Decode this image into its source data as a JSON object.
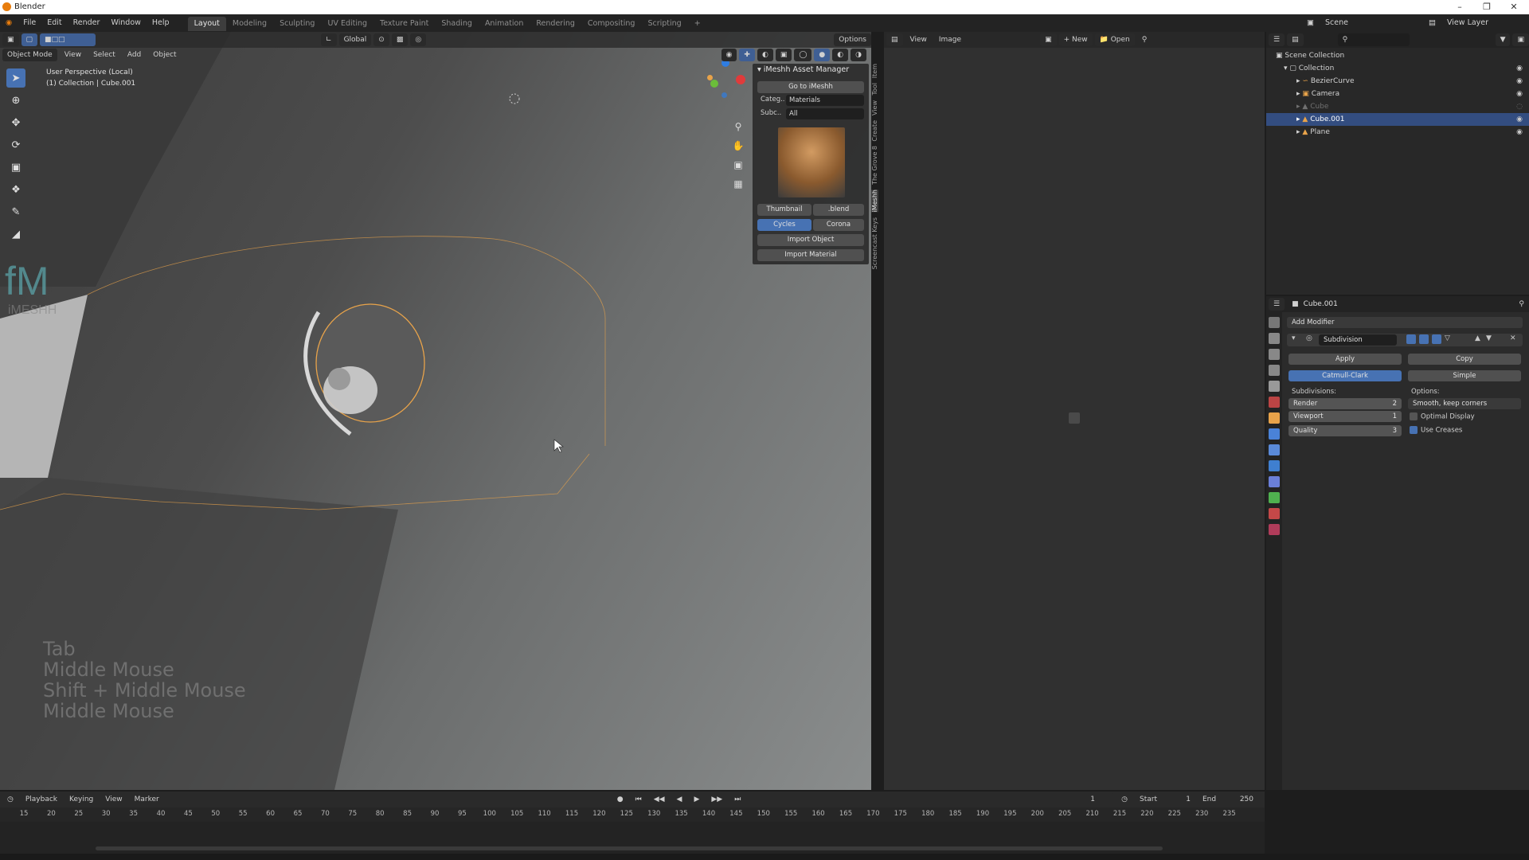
{
  "app": {
    "title": "Blender"
  },
  "menu": [
    "File",
    "Edit",
    "Render",
    "Window",
    "Help"
  ],
  "workspaces": [
    "Layout",
    "Modeling",
    "Sculpting",
    "UV Editing",
    "Texture Paint",
    "Shading",
    "Animation",
    "Rendering",
    "Compositing",
    "Scripting"
  ],
  "active_workspace": "Layout",
  "scene_label": "Scene",
  "view_layer_label": "View Layer",
  "viewport": {
    "transform_orientation": "Global",
    "options_label": "Options",
    "mode": "Object Mode",
    "header_menus": [
      "View",
      "Select",
      "Add",
      "Object"
    ],
    "perspective": "User Perspective (Local)",
    "collection_info": "(1) Collection | Cube.001",
    "key_overlay": [
      "Tab",
      "Middle Mouse",
      "Shift + Middle Mouse",
      "Middle Mouse"
    ],
    "watermark_logo_text": "iMESHH"
  },
  "npanel": {
    "title": "iMeshh Asset Manager",
    "goto_label": "Go to iMeshh",
    "category_label": "Categ..",
    "category_value": "Materials",
    "subcategory_label": "Subc..",
    "subcategory_value": "All",
    "thumbnail_label": "Thumbnail",
    "blend_label": ".blend",
    "engine_cycles": "Cycles",
    "engine_corona": "Corona",
    "import_object": "Import Object",
    "import_material": "Import Material",
    "tabs": [
      "Item",
      "Tool",
      "View",
      "Create",
      "The Grove 8",
      "iMeshh",
      "Screencast Keys"
    ],
    "active_tab": "iMeshh"
  },
  "image_editor": {
    "menus": [
      "View",
      "Image"
    ],
    "new_label": "New",
    "open_label": "Open"
  },
  "outliner": {
    "root": "Scene Collection",
    "items": [
      {
        "label": "Collection",
        "level": 1,
        "selected": false
      },
      {
        "label": "BezierCurve",
        "level": 2,
        "selected": false
      },
      {
        "label": "Camera",
        "level": 2,
        "selected": false
      },
      {
        "label": "Cube",
        "level": 2,
        "selected": false,
        "dim": true
      },
      {
        "label": "Cube.001",
        "level": 2,
        "selected": true
      },
      {
        "label": "Plane",
        "level": 2,
        "selected": false
      }
    ]
  },
  "properties": {
    "object_name": "Cube.001",
    "add_modifier_label": "Add Modifier",
    "modifier_name": "Subdivision",
    "apply_label": "Apply",
    "copy_label": "Copy",
    "catmull_label": "Catmull-Clark",
    "simple_label": "Simple",
    "subdivisions_label": "Subdivisions:",
    "options_label": "Options:",
    "render_label": "Render",
    "render_value": "2",
    "viewport_label": "Viewport",
    "viewport_value": "1",
    "quality_label": "Quality",
    "quality_value": "3",
    "uv_smooth_value": "Smooth, keep corners",
    "optimal_display_label": "Optimal Display",
    "optimal_display_checked": false,
    "use_creases_label": "Use Creases",
    "use_creases_checked": true
  },
  "timeline": {
    "menus": [
      "Playback",
      "Keying",
      "View",
      "Marker"
    ],
    "current_frame": "1",
    "start_label": "Start",
    "start_value": "1",
    "end_label": "End",
    "end_value": "250",
    "ruler_ticks": [
      "15",
      "20",
      "25",
      "30",
      "35",
      "40",
      "45",
      "50",
      "55",
      "60",
      "65",
      "70",
      "75",
      "80",
      "85",
      "90",
      "95",
      "100",
      "105",
      "110",
      "115",
      "120",
      "125",
      "130",
      "135",
      "140",
      "145",
      "150",
      "155",
      "160",
      "165",
      "170",
      "175",
      "180",
      "185",
      "190",
      "195",
      "200",
      "205",
      "210",
      "215",
      "220",
      "225",
      "230",
      "235"
    ]
  },
  "colors": {
    "accent_blue": "#4772b3",
    "selection_orange": "#e8a34a",
    "header_bg": "#232323"
  }
}
